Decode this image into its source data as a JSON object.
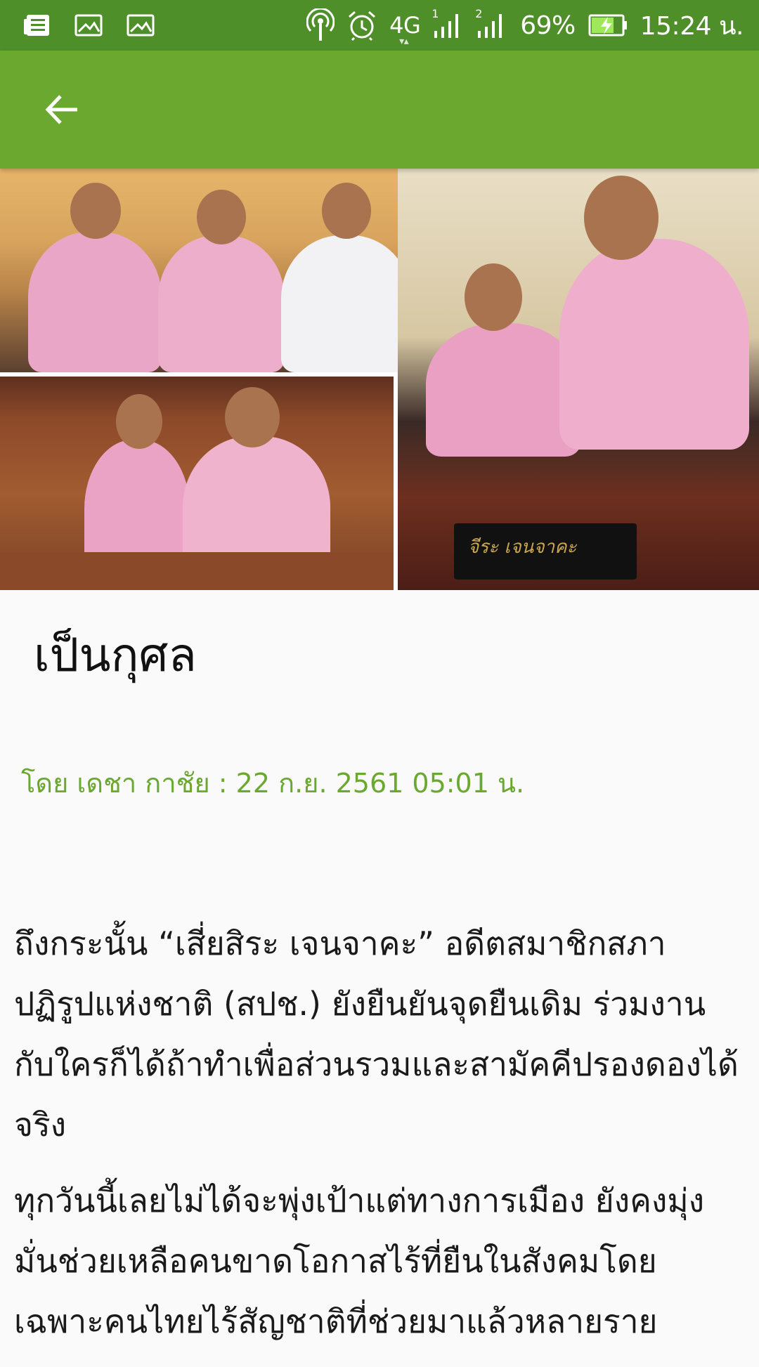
{
  "status_bar": {
    "network_label": "4G",
    "sim1_label": "1",
    "sim2_label": "2",
    "battery_text": "69%",
    "time": "15:24 น.",
    "icons": [
      "notification-news-icon",
      "image-icon",
      "image-icon",
      "hotspot-icon",
      "alarm-icon",
      "signal-icon",
      "battery-charging-icon"
    ]
  },
  "app_bar": {
    "back_icon": "arrow-left-icon",
    "background_color": "#6aa82f"
  },
  "hero": {
    "nameplate_text": "จีระ เจนจาคะ"
  },
  "article": {
    "headline": "เป็นกุศล",
    "byline": "โดย เดชา กาชัย : 22 ก.ย. 2561 05:01 น.",
    "accent_color": "#6aa82f",
    "paragraphs": [
      "ถึงกระนั้น “เสี่ยสิระ เจนจาคะ” อดีตสมาชิกสภาปฏิรูปแห่งชาติ (สปช.) ยังยืนยันจุดยืนเดิม ร่วมงานกับใครก็ได้ถ้าทำเพื่อส่วนรวมและสามัคคีปรองดองได้จริง",
      "ทุกวันนี้เลยไม่ได้จะพุ่งเป้าแต่ทางการเมือง ยังคงมุ่งมั่นช่วยเหลือคนขาดโอกาสไร้ที่ยืนในสังคมโดยเฉพาะคนไทยไร้สัญชาติที่ช่วยมาแล้วหลายราย"
    ]
  }
}
